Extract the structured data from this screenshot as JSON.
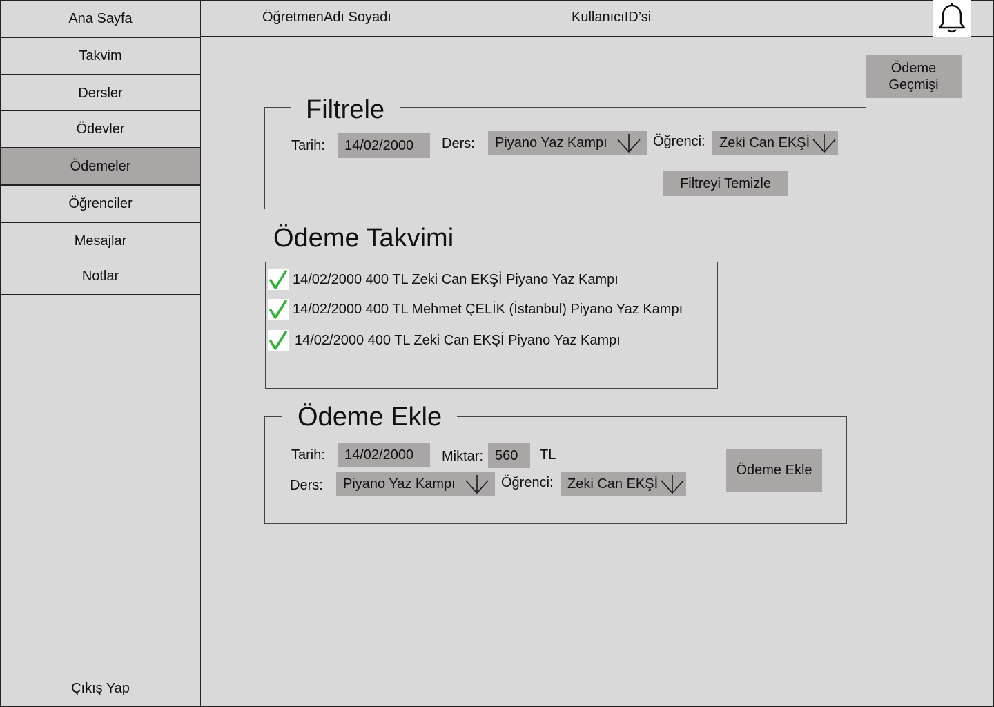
{
  "sidebar": {
    "home": "Ana Sayfa",
    "items": [
      "Takvim",
      "Dersler",
      "Ödevler",
      "Ödemeler",
      "Öğrenciler",
      "Mesajlar",
      "Notlar"
    ],
    "active": "Ödemeler",
    "logout": "Çıkış Yap"
  },
  "header": {
    "teacher_name": "ÖğretmenAdı Soyadı",
    "user_id": "KullanıcıID’si",
    "bell_icon": "bell-icon"
  },
  "history_button": "Ödeme Geçmişi",
  "filter": {
    "title": "Filtrele",
    "date_label": "Tarih:",
    "date_value": "14/02/2000",
    "course_label": "Ders:",
    "course_value": "Piyano Yaz Kampı",
    "student_label": "Öğrenci:",
    "student_value": "Zeki Can EKŞİ",
    "clear_button": "Filtreyi Temizle"
  },
  "schedule": {
    "title": "Ödeme Takvimi",
    "rows": [
      "14/02/2000 400 TL Zeki Can EKŞİ Piyano Yaz Kampı",
      "14/02/2000 400 TL Mehmet ÇELİK (İstanbul) Piyano Yaz Kampı",
      "14/02/2000 400 TL Zeki Can EKŞİ Piyano Yaz Kampı"
    ]
  },
  "add": {
    "title": "Ödeme Ekle",
    "date_label": "Tarih:",
    "date_value": "14/02/2000",
    "amount_label": "Miktar:",
    "amount_value": "560",
    "currency": "TL",
    "course_label": "Ders:",
    "course_value": "Piyano Yaz Kampı",
    "student_label": "Öğrenci:",
    "student_value": "Zeki Can EKŞİ",
    "submit_button": "Ödeme Ekle"
  },
  "colors": {
    "background": "#d9d9d9",
    "control": "#aaa6a6",
    "check": "#2bb534"
  }
}
